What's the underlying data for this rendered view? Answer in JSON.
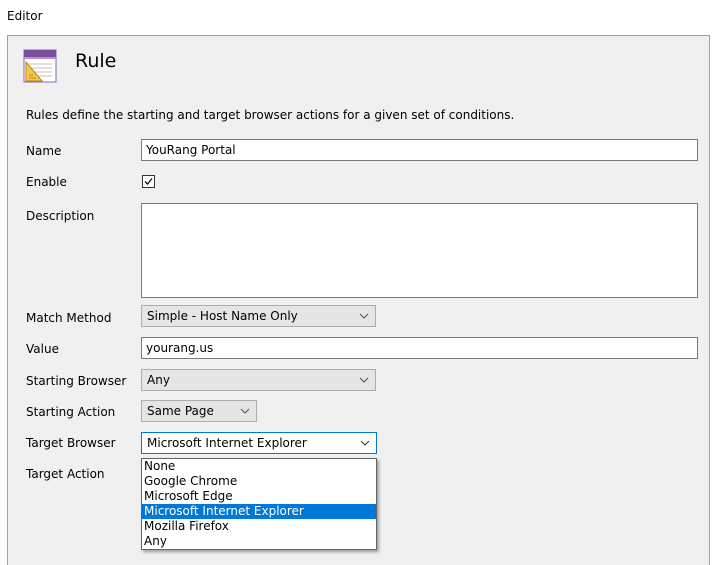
{
  "window": {
    "title": "Editor"
  },
  "header": {
    "title": "Rule",
    "icon": "rule-document-icon"
  },
  "description_text": "Rules define the starting and target browser actions for a given set of conditions.",
  "fields": {
    "name": {
      "label": "Name",
      "value": "YouRang Portal"
    },
    "enable": {
      "label": "Enable",
      "checked": true
    },
    "description": {
      "label": "Description",
      "value": ""
    },
    "match_method": {
      "label": "Match Method",
      "value": "Simple - Host Name Only"
    },
    "value": {
      "label": "Value",
      "value": "yourang.us"
    },
    "starting_browser": {
      "label": "Starting Browser",
      "value": "Any"
    },
    "starting_action": {
      "label": "Starting Action",
      "value": "Same Page"
    },
    "target_browser": {
      "label": "Target Browser",
      "value": "Microsoft Internet Explorer"
    },
    "target_action": {
      "label": "Target Action"
    }
  },
  "target_browser_options": [
    "None",
    "Google Chrome",
    "Microsoft Edge",
    "Microsoft Internet Explorer",
    "Mozilla Firefox",
    "Any"
  ],
  "colors": {
    "selection": "#0078d7",
    "panel_bg": "#f0f0f0",
    "combo_bg": "#e5e5e5"
  }
}
